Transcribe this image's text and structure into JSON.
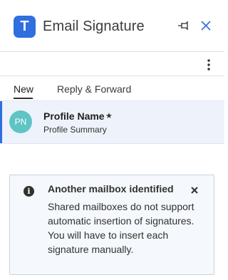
{
  "header": {
    "logo_letter": "T",
    "title": "Email Signature",
    "icons": {
      "pin": "pin-icon",
      "close": "close-icon"
    }
  },
  "toolbar": {
    "more_icon": "more-vertical-icon"
  },
  "tabs": [
    {
      "label": "New",
      "active": true
    },
    {
      "label": "Reply & Forward",
      "active": false
    }
  ],
  "profile": {
    "initials": "PN",
    "name": "Profile Name",
    "star": "★",
    "summary": "Profile Summary"
  },
  "notice": {
    "icon": "info-icon",
    "icon_glyph": "i",
    "title": "Another mailbox identified",
    "body": "Shared mailboxes do not support automatic insertion of signatures. You will have to insert each signature manually."
  },
  "colors": {
    "accent": "#2f6fdf",
    "avatar": "#5fc4c4",
    "selected_bg": "#eef3fb",
    "notice_bg": "#f5f8fc"
  }
}
